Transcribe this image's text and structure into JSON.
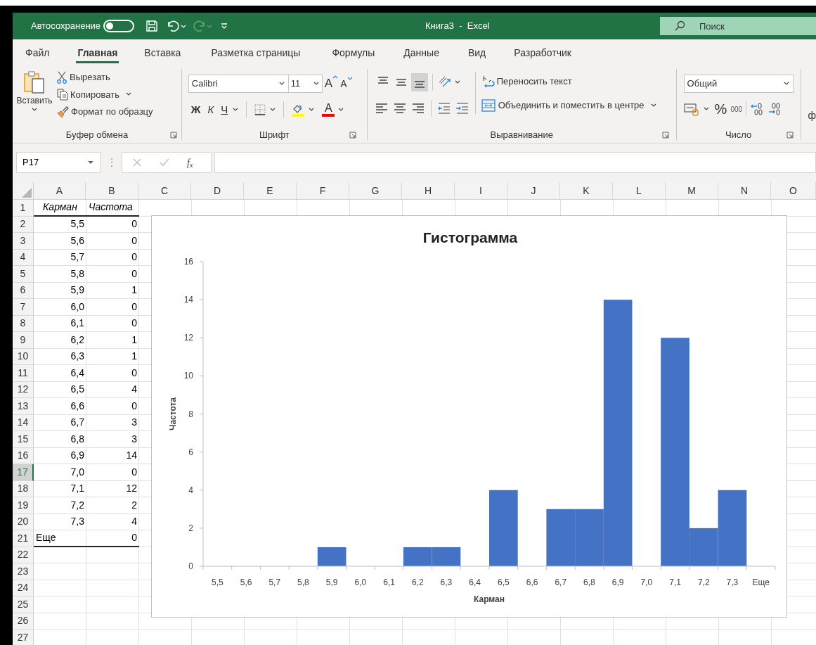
{
  "title_bar": {
    "autosave": {
      "label": "Автосохранение",
      "on": false
    },
    "title": "Книга3  -  Excel",
    "search": {
      "placeholder": "Поиск"
    }
  },
  "ribbon_tabs": [
    {
      "label": "Файл",
      "selected": false
    },
    {
      "label": "Главная",
      "selected": true
    },
    {
      "label": "Вставка",
      "selected": false
    },
    {
      "label": "Разметка страницы",
      "selected": false
    },
    {
      "label": "Формулы",
      "selected": false
    },
    {
      "label": "Данные",
      "selected": false
    },
    {
      "label": "Вид",
      "selected": false
    },
    {
      "label": "Разработчик",
      "selected": false
    }
  ],
  "ribbon": {
    "clipboard": {
      "paste": "Вставить",
      "cut": "Вырезать",
      "copy": "Копировать",
      "format_painter": "Формат по образцу",
      "group": "Буфер обмена"
    },
    "font": {
      "name": "Calibri",
      "size": "11",
      "grow": "A",
      "shrink": "A",
      "bold": "Ж",
      "italic": "К",
      "underline": "Ч",
      "font_color": "A",
      "group": "Шрифт"
    },
    "alignment": {
      "vertical": [
        {
          "selected": false
        },
        {
          "selected": false
        },
        {
          "selected": true
        }
      ],
      "wrap_text": "Переносить текст",
      "merge_center": "Объединить и поместить в центре",
      "group": "Выравнивание"
    },
    "number": {
      "format": "Общий",
      "percent": "%",
      "thousands": "000",
      "group": "Число"
    },
    "next_group_partial": "ф"
  },
  "formula_bar": {
    "name_box": "P17",
    "function_label": "f$_{x}$"
  },
  "sheet": {
    "columns": [
      "A",
      "B",
      "C",
      "D",
      "E",
      "F",
      "G",
      "H",
      "I",
      "J",
      "K",
      "L",
      "M",
      "N",
      "O"
    ],
    "rows": [
      {
        "number": "1",
        "kind": "header",
        "a": "Карман",
        "b": "Частота",
        "selected": false
      },
      {
        "number": "2",
        "kind": "value",
        "a": "5,5",
        "b": "0",
        "selected": false
      },
      {
        "number": "3",
        "kind": "value",
        "a": "5,6",
        "b": "0",
        "selected": false
      },
      {
        "number": "4",
        "kind": "value",
        "a": "5,7",
        "b": "0",
        "selected": false
      },
      {
        "number": "5",
        "kind": "value",
        "a": "5,8",
        "b": "0",
        "selected": false
      },
      {
        "number": "6",
        "kind": "value",
        "a": "5,9",
        "b": "1",
        "selected": false
      },
      {
        "number": "7",
        "kind": "value",
        "a": "6,0",
        "b": "0",
        "selected": false
      },
      {
        "number": "8",
        "kind": "value",
        "a": "6,1",
        "b": "0",
        "selected": false
      },
      {
        "number": "9",
        "kind": "value",
        "a": "6,2",
        "b": "1",
        "selected": false
      },
      {
        "number": "10",
        "kind": "value",
        "a": "6,3",
        "b": "1",
        "selected": false
      },
      {
        "number": "11",
        "kind": "value",
        "a": "6,4",
        "b": "0",
        "selected": false
      },
      {
        "number": "12",
        "kind": "value",
        "a": "6,5",
        "b": "4",
        "selected": false
      },
      {
        "number": "13",
        "kind": "value",
        "a": "6,6",
        "b": "0",
        "selected": false
      },
      {
        "number": "14",
        "kind": "value",
        "a": "6,7",
        "b": "3",
        "selected": false
      },
      {
        "number": "15",
        "kind": "value",
        "a": "6,8",
        "b": "3",
        "selected": false
      },
      {
        "number": "16",
        "kind": "value",
        "a": "6,9",
        "b": "14",
        "selected": false
      },
      {
        "number": "17",
        "kind": "value",
        "a": "7,0",
        "b": "0",
        "selected": true
      },
      {
        "number": "18",
        "kind": "value",
        "a": "7,1",
        "b": "12",
        "selected": false
      },
      {
        "number": "19",
        "kind": "value",
        "a": "7,2",
        "b": "2",
        "selected": false
      },
      {
        "number": "20",
        "kind": "value",
        "a": "7,3",
        "b": "4",
        "selected": false
      },
      {
        "number": "21",
        "kind": "total",
        "a": "Еще",
        "b": "0",
        "selected": false
      },
      {
        "number": "22",
        "kind": "empty",
        "selected": false
      },
      {
        "number": "23",
        "kind": "empty",
        "selected": false
      },
      {
        "number": "24",
        "kind": "empty",
        "selected": false
      },
      {
        "number": "25",
        "kind": "empty",
        "selected": false
      },
      {
        "number": "26",
        "kind": "empty",
        "selected": false
      },
      {
        "number": "27",
        "kind": "empty",
        "selected": false
      }
    ]
  },
  "chart": {
    "chart_data": {
      "type": "bar",
      "title": "Гистограмма",
      "xlabel": "Карман",
      "ylabel": "Частота",
      "categories": [
        "5,5",
        "5,6",
        "5,7",
        "5,8",
        "5,9",
        "6,0",
        "6,1",
        "6,2",
        "6,3",
        "6,4",
        "6,5",
        "6,6",
        "6,7",
        "6,8",
        "6,9",
        "7,0",
        "7,1",
        "7,2",
        "7,3",
        "Еще"
      ],
      "series": [
        {
          "color": "#4472c4",
          "values": [
            0,
            0,
            0,
            0,
            1,
            0,
            0,
            1,
            1,
            0,
            4,
            0,
            3,
            3,
            14,
            0,
            12,
            2,
            4,
            0
          ]
        }
      ],
      "ylim": [
        0,
        16
      ],
      "yticks": [
        0,
        2,
        4,
        6,
        8,
        10,
        12,
        14,
        16
      ]
    }
  }
}
